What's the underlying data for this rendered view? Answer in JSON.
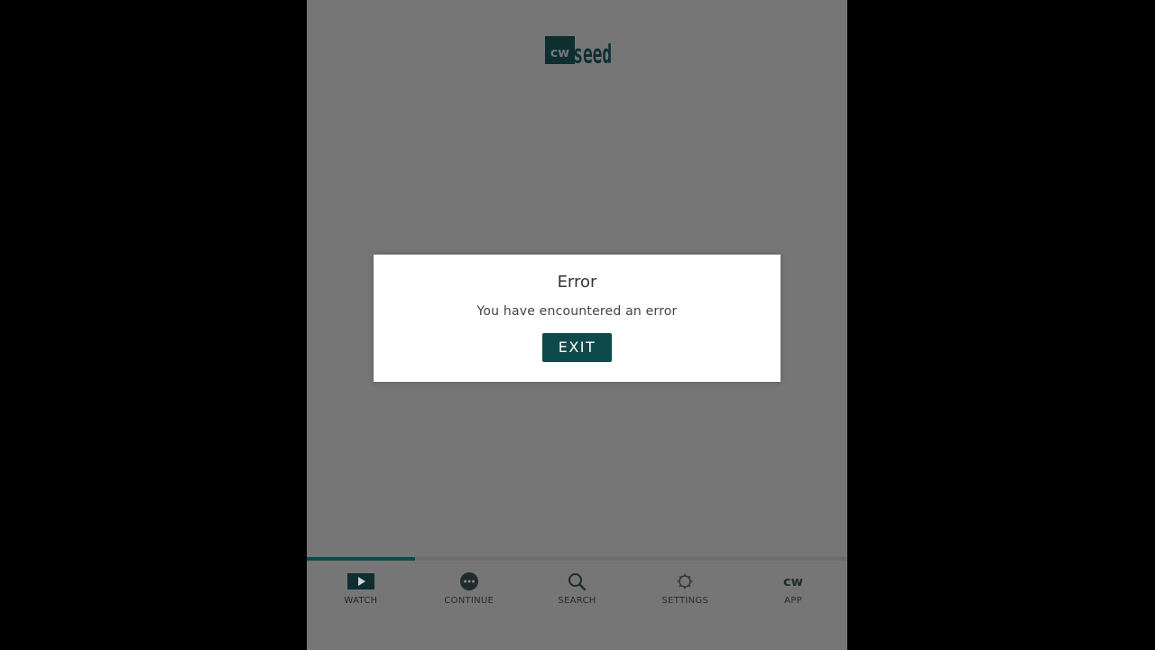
{
  "app": {
    "logo": {
      "cw": "cw",
      "seed": "seed",
      "icon": "cw-seed-logo"
    }
  },
  "dialog": {
    "title": "Error",
    "message": "You have encountered an error",
    "exit_label": "EXIT"
  },
  "progress": {
    "fraction": 0.2
  },
  "tabs": [
    {
      "label": "WATCH",
      "icon": "play-icon",
      "active": true
    },
    {
      "label": "CONTINUE",
      "icon": "ellipsis-icon",
      "active": false
    },
    {
      "label": "SEARCH",
      "icon": "search-icon",
      "active": false
    },
    {
      "label": "SETTINGS",
      "icon": "gear-icon",
      "active": false
    },
    {
      "label": "APP",
      "icon": "cw-logo-icon",
      "active": false
    }
  ],
  "colors": {
    "accent": "#0e4a4b",
    "background": "#767676",
    "dialog": "#ffffff"
  }
}
